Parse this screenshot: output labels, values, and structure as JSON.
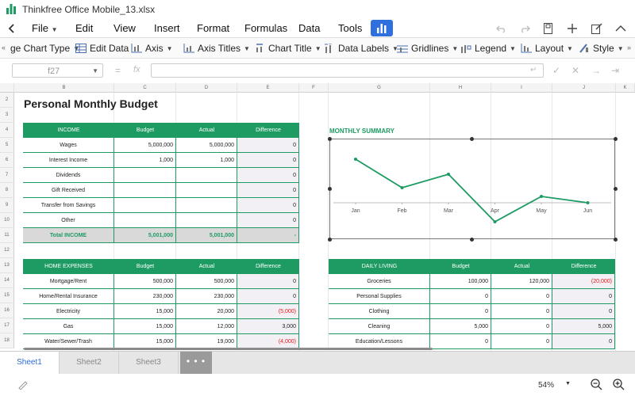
{
  "window": {
    "title": "Thinkfree Office Mobile_13.xlsx"
  },
  "menubar": {
    "items": [
      "File",
      "Edit",
      "View",
      "Insert",
      "Format",
      "Formulas",
      "Data",
      "Tools"
    ],
    "active_icon": "chart-icon"
  },
  "chart_toolbar": {
    "items": [
      "ge Chart Type",
      "Edit Data",
      "Axis",
      "Axis Titles",
      "Chart Title",
      "Data Labels",
      "Gridlines",
      "Legend",
      "Layout",
      "Style"
    ]
  },
  "formula_bar": {
    "cell_ref": "f27",
    "value": ""
  },
  "columns": [
    "B",
    "C",
    "D",
    "E",
    "F",
    "G",
    "H",
    "I",
    "J",
    "K"
  ],
  "rows": [
    "2",
    "3",
    "4",
    "5",
    "6",
    "7",
    "8",
    "9",
    "10",
    "11",
    "12",
    "13",
    "14",
    "15",
    "16",
    "17",
    "18"
  ],
  "sheet": {
    "title": "Personal Monthly Budget",
    "income": {
      "headers": [
        "INCOME",
        "Budget",
        "Actual",
        "Difference"
      ],
      "rows": [
        [
          "Wages",
          "5,000,000",
          "5,000,000",
          "0"
        ],
        [
          "Interest Income",
          "1,000",
          "1,000",
          "0"
        ],
        [
          "Dividends",
          "",
          "",
          "0"
        ],
        [
          "Gift Received",
          "",
          "",
          "0"
        ],
        [
          "Transfer from Savings",
          "",
          "",
          "0"
        ],
        [
          "Other",
          "",
          "",
          "0"
        ]
      ],
      "total": [
        "Total INCOME",
        "5,001,000",
        "5,001,000",
        "-"
      ]
    },
    "home_expenses": {
      "headers": [
        "HOME EXPENSES",
        "Budget",
        "Actual",
        "Difference"
      ],
      "rows": [
        [
          "Mortgage/Rent",
          "500,000",
          "500,000",
          "0"
        ],
        [
          "Home/Rental Insurance",
          "230,000",
          "230,000",
          "0"
        ],
        [
          "Electricity",
          "15,000",
          "20,000",
          "(5,000)"
        ],
        [
          "Gas",
          "15,000",
          "12,000",
          "3,000"
        ],
        [
          "Water/Sewer/Trash",
          "15,000",
          "19,000",
          "(4,000)"
        ]
      ]
    },
    "daily_living": {
      "headers": [
        "DAILY LIVING",
        "Budget",
        "Actual",
        "Difference"
      ],
      "rows": [
        [
          "Groceries",
          "100,000",
          "120,000",
          "(20,000)"
        ],
        [
          "Personal Supplies",
          "0",
          "0",
          "0"
        ],
        [
          "Clothing",
          "0",
          "0",
          "0"
        ],
        [
          "Cleaning",
          "5,000",
          "0",
          "5,000"
        ],
        [
          "Education/Lessons",
          "0",
          "0",
          "0"
        ]
      ]
    },
    "monthly_summary_title": "MONTHLY SUMMARY"
  },
  "chart_data": {
    "type": "line",
    "title": "",
    "categories": [
      "Jan",
      "Feb",
      "Mar",
      "Apr",
      "May",
      "Jun"
    ],
    "series": [
      {
        "values": [
          0.55,
          0.19,
          0.36,
          -0.24,
          0.08,
          0.0
        ]
      }
    ],
    "ylim": [
      -0.3,
      0.7
    ],
    "color": "#1e9b63",
    "gridlines": false,
    "legend": "none"
  },
  "tabs": {
    "items": [
      "Sheet1",
      "Sheet2",
      "Sheet3"
    ],
    "active": "Sheet1",
    "more": "• • •"
  },
  "status": {
    "zoom": "54%"
  },
  "colors": {
    "accent": "#1e9b63",
    "negative": "#e01818",
    "tab_active": "#2c6ad8",
    "toolbar_active": "#2f6fde"
  }
}
